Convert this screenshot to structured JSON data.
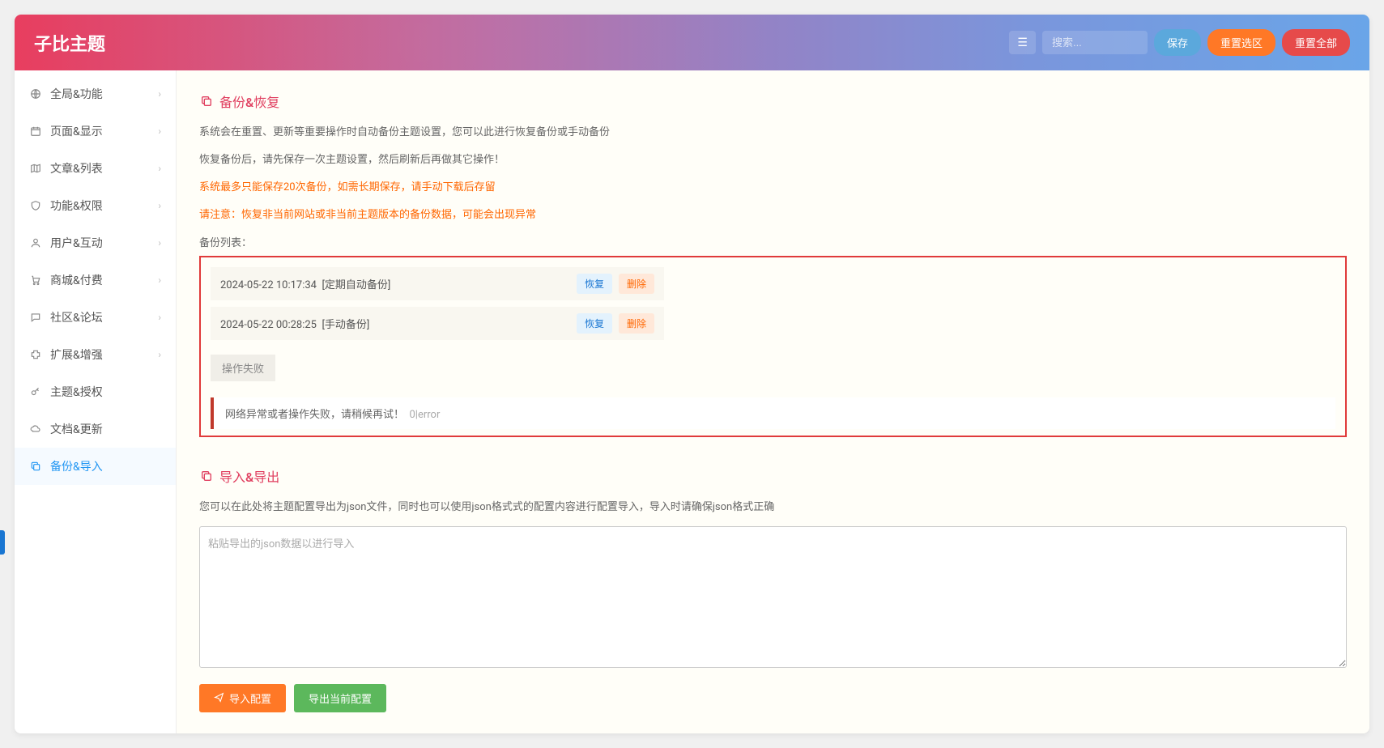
{
  "header": {
    "title": "子比主题",
    "search_placeholder": "搜索...",
    "menu_toggle_text": "☰",
    "save_label": "保存",
    "reset_area_label": "重置选区",
    "reset_all_label": "重置全部"
  },
  "sidebar": {
    "items": [
      {
        "label": "全局&功能",
        "has_children": true
      },
      {
        "label": "页面&显示",
        "has_children": true
      },
      {
        "label": "文章&列表",
        "has_children": true
      },
      {
        "label": "功能&权限",
        "has_children": true
      },
      {
        "label": "用户&互动",
        "has_children": true
      },
      {
        "label": "商城&付费",
        "has_children": true
      },
      {
        "label": "社区&论坛",
        "has_children": true
      },
      {
        "label": "扩展&增强",
        "has_children": true
      },
      {
        "label": "主题&授权",
        "has_children": false
      },
      {
        "label": "文档&更新",
        "has_children": false
      },
      {
        "label": "备份&导入",
        "has_children": false
      }
    ],
    "active_index": 10
  },
  "backup_section": {
    "title": "备份&恢复",
    "line1": "系统会在重置、更新等重要操作时自动备份主题设置，您可以此进行恢复备份或手动备份",
    "line2": "恢复备份后，请先保存一次主题设置，然后刷新后再做其它操作！",
    "warn1": "系统最多只能保存20次备份，如需长期保存，请手动下载后存留",
    "warn2": "请注意：恢复非当前网站或非当前主题版本的备份数据，可能会出现异常",
    "list_label": "备份列表：",
    "rows": [
      {
        "time": "2024-05-22 10:17:34",
        "tag": "[定期自动备份]"
      },
      {
        "time": "2024-05-22 00:28:25",
        "tag": "[手动备份]"
      }
    ],
    "restore_label": "恢复",
    "delete_label": "删除",
    "op_fail_label": "操作失败",
    "error_msg": "网络异常或者操作失败，请稍候再试！",
    "error_code": "0|error"
  },
  "import_section": {
    "title": "导入&导出",
    "desc": "您可以在此处将主题配置导出为json文件，同时也可以使用json格式式的配置内容进行配置导入，导入时请确保json格式正确",
    "textarea_placeholder": "粘贴导出的json数据以进行导入",
    "import_btn": "导入配置",
    "export_btn": "导出当前配置"
  }
}
